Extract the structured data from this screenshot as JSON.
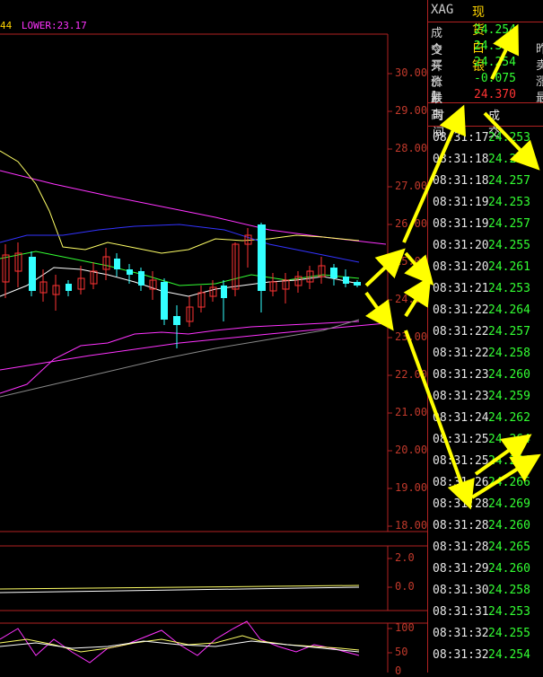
{
  "indicator_line": {
    "left": "44",
    "right": "LOWER:23.17"
  },
  "y_axis": [
    "30.000",
    "29.000",
    "28.000",
    "27.000",
    "26.000",
    "25.000",
    "24.000",
    "23.000",
    "22.000",
    "21.000",
    "20.000",
    "19.000",
    "18.000"
  ],
  "macd_axis": [
    "2.0",
    "0.0"
  ],
  "kdj_axis": [
    "100",
    "50",
    "0"
  ],
  "quote": {
    "symbol": "XAG",
    "name": "现货白银",
    "rows": [
      {
        "label": "成交",
        "value": "24.254",
        "color": "#33ff33",
        "edge": ""
      },
      {
        "label": "今开",
        "value": "24.314",
        "color": "#33ff33",
        "edge": "昨"
      },
      {
        "label": "买价1",
        "value": "24.254",
        "color": "#33ff33",
        "edge": "卖"
      },
      {
        "label": "涨跌",
        "value": "-0.075",
        "color": "#33ff33",
        "edge": "涨"
      },
      {
        "label": "最高",
        "value": "24.370",
        "color": "#ff3333",
        "edge": "最"
      }
    ]
  },
  "ticks_header": {
    "time": "时间",
    "price": "成交"
  },
  "ticks": [
    {
      "time": "08:31:17",
      "price": "24.253"
    },
    {
      "time": "08:31:18",
      "price": "24.257"
    },
    {
      "time": "08:31:18",
      "price": "24.257"
    },
    {
      "time": "08:31:19",
      "price": "24.253"
    },
    {
      "time": "08:31:19",
      "price": "24.257"
    },
    {
      "time": "08:31:20",
      "price": "24.255"
    },
    {
      "time": "08:31:20",
      "price": "24.261"
    },
    {
      "time": "08:31:21",
      "price": "24.253"
    },
    {
      "time": "08:31:22",
      "price": "24.264"
    },
    {
      "time": "08:31:22",
      "price": "24.257"
    },
    {
      "time": "08:31:22",
      "price": "24.258"
    },
    {
      "time": "08:31:23",
      "price": "24.260"
    },
    {
      "time": "08:31:23",
      "price": "24.259"
    },
    {
      "time": "08:31:24",
      "price": "24.262"
    },
    {
      "time": "08:31:25",
      "price": "24.264"
    },
    {
      "time": "08:31:25",
      "price": "24.264"
    },
    {
      "time": "08:31:26",
      "price": "24.266"
    },
    {
      "time": "08:31:28",
      "price": "24.269"
    },
    {
      "time": "08:31:28",
      "price": "24.260"
    },
    {
      "time": "08:31:28",
      "price": "24.265"
    },
    {
      "time": "08:31:29",
      "price": "24.260"
    },
    {
      "time": "08:31:30",
      "price": "24.258"
    },
    {
      "time": "08:31:31",
      "price": "24.253"
    },
    {
      "time": "08:31:32",
      "price": "24.255"
    },
    {
      "time": "08:31:32",
      "price": "24.254"
    }
  ],
  "colors": {
    "grid": "#b22222",
    "up": "#ff3333",
    "down": "#33ffff",
    "tick_price": "#33ff33",
    "arrow": "#ffff00",
    "ma_upper": "#ff33ff",
    "ma_mid": "#3333ff"
  }
}
